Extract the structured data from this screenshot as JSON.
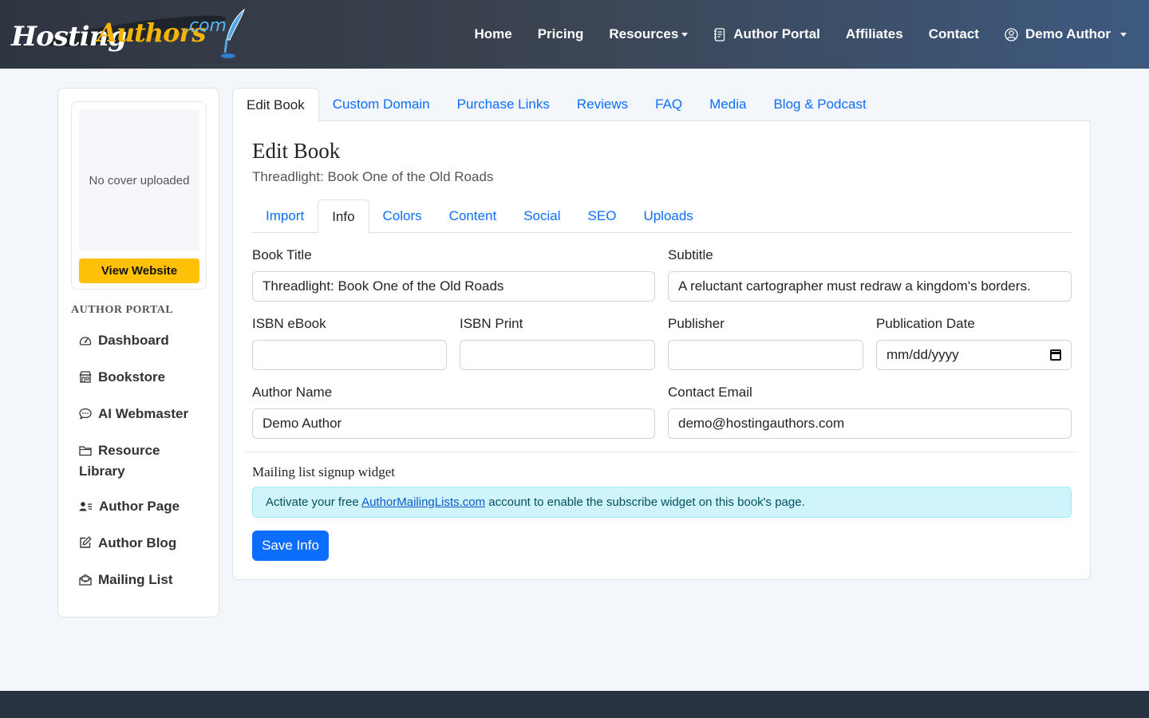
{
  "brand": {
    "part1": "Hosting",
    "part2": "Authors",
    "part3": ".com"
  },
  "nav": {
    "home": "Home",
    "pricing": "Pricing",
    "resources": "Resources",
    "author_portal": "Author Portal",
    "affiliates": "Affiliates",
    "contact": "Contact",
    "user": "Demo Author"
  },
  "sidebar": {
    "cover_placeholder": "No cover uploaded",
    "view_website": "View Website",
    "heading": "AUTHOR PORTAL",
    "items": [
      {
        "label": "Dashboard",
        "icon": "speedometer-icon"
      },
      {
        "label": "Bookstore",
        "icon": "shop-icon"
      },
      {
        "label": "AI Webmaster",
        "icon": "chat-icon"
      },
      {
        "label": "Resource Library",
        "icon": "folder-icon"
      },
      {
        "label": "Author Page",
        "icon": "person-lines-icon"
      },
      {
        "label": "Author Blog",
        "icon": "pencil-square-icon"
      },
      {
        "label": "Mailing List",
        "icon": "envelope-open-icon"
      }
    ]
  },
  "top_tabs": [
    "Edit Book",
    "Custom Domain",
    "Purchase Links",
    "Reviews",
    "FAQ",
    "Media",
    "Blog & Podcast"
  ],
  "panel": {
    "title": "Edit Book",
    "subtitle": "Threadlight: Book One of the Old Roads"
  },
  "inner_tabs": [
    "Import",
    "Info",
    "Colors",
    "Content",
    "Social",
    "SEO",
    "Uploads"
  ],
  "form": {
    "book_title_label": "Book Title",
    "book_title_value": "Threadlight: Book One of the Old Roads",
    "subtitle_label": "Subtitle",
    "subtitle_value": "A reluctant cartographer must redraw a kingdom's borders.",
    "isbn_ebook_label": "ISBN eBook",
    "isbn_ebook_value": "",
    "isbn_print_label": "ISBN Print",
    "isbn_print_value": "",
    "publisher_label": "Publisher",
    "publisher_value": "",
    "pub_date_label": "Publication Date",
    "pub_date_value": "mm/dd/yyyy",
    "author_name_label": "Author Name",
    "author_name_value": "Demo Author",
    "contact_email_label": "Contact Email",
    "contact_email_value": "demo@hostingauthors.com"
  },
  "widget": {
    "title": "Mailing list signup widget",
    "alert_prefix": "Activate your free ",
    "alert_link": "AuthorMailingLists.com",
    "alert_suffix": " account to enable the subscribe widget on this book's page."
  },
  "save_button": "Save Info",
  "colors": {
    "primary": "#0d6efd",
    "warning": "#ffc107",
    "info_bg": "#cff4fc",
    "navbar": "#3b4350",
    "footer": "#293241"
  }
}
